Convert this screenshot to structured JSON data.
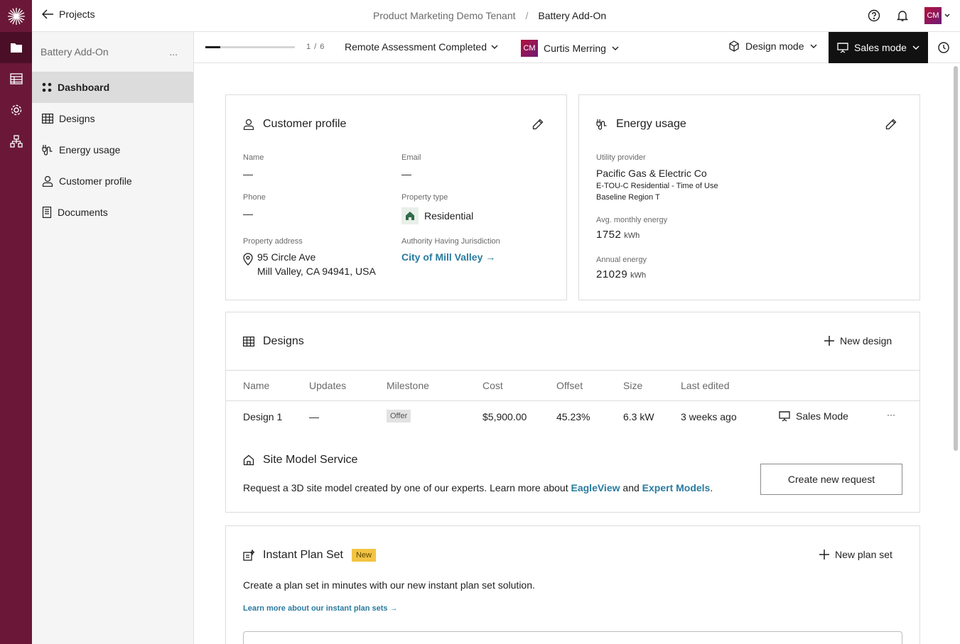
{
  "topbar": {
    "back_label": "Projects",
    "breadcrumb_tenant": "Product Marketing Demo Tenant",
    "breadcrumb_separator": "/",
    "breadcrumb_project": "Battery Add-On",
    "user_initials": "CM"
  },
  "sidebar": {
    "project_name": "Battery Add-On",
    "more_label": "...",
    "items": [
      {
        "label": "Dashboard",
        "icon": "dashboard-icon",
        "active": true
      },
      {
        "label": "Designs",
        "icon": "grid-icon"
      },
      {
        "label": "Energy usage",
        "icon": "plug-icon"
      },
      {
        "label": "Customer profile",
        "icon": "person-icon"
      },
      {
        "label": "Documents",
        "icon": "document-icon"
      }
    ]
  },
  "subbar": {
    "progress_text": "1 / 6",
    "progress_fraction": 0.1667,
    "milestone": "Remote Assessment Completed",
    "owner_initials": "CM",
    "owner_name": "Curtis Merring",
    "design_mode": "Design mode",
    "sales_mode": "Sales mode"
  },
  "customer_profile": {
    "title": "Customer profile",
    "name_label": "Name",
    "name_value": "—",
    "email_label": "Email",
    "email_value": "—",
    "phone_label": "Phone",
    "phone_value": "—",
    "property_type_label": "Property type",
    "property_type_value": "Residential",
    "address_label": "Property address",
    "address_line1": "95 Circle Ave",
    "address_line2": "Mill Valley, CA 94941, USA",
    "ahj_label": "Authority Having Jurisdiction",
    "ahj_value": "City of Mill Valley →"
  },
  "energy_usage": {
    "title": "Energy usage",
    "utility_label": "Utility provider",
    "utility_name": "Pacific Gas & Electric Co",
    "rate_plan": "E-TOU-C Residential - Time of Use",
    "baseline": "Baseline Region T",
    "monthly_label": "Avg. monthly energy",
    "monthly_value": "1752",
    "annual_label": "Annual energy",
    "annual_value": "21029",
    "unit": "kWh"
  },
  "designs": {
    "title": "Designs",
    "new_label": "New design",
    "columns": [
      "Name",
      "Updates",
      "Milestone",
      "Cost",
      "Offset",
      "Size",
      "Last edited"
    ],
    "row": {
      "name": "Design 1",
      "updates": "—",
      "milestone": "Offer",
      "cost": "$5,900.00",
      "offset": "45.23%",
      "size": "6.3 kW",
      "last_edited": "3 weeks ago",
      "mode": "Sales Mode",
      "more": "···"
    }
  },
  "site_model": {
    "title": "Site Model Service",
    "desc_prefix": "Request a 3D site model created by one of our experts. Learn more about ",
    "link1": "EagleView",
    "and": " and ",
    "link2": "Expert Models",
    "desc_suffix": ".",
    "button": "Create new request"
  },
  "plan_set": {
    "title": "Instant Plan Set",
    "badge": "New",
    "new_label": "New plan set",
    "desc": "Create a plan set in minutes with our new instant plan set solution.",
    "learn_more": "Learn more about our instant plan sets →"
  }
}
